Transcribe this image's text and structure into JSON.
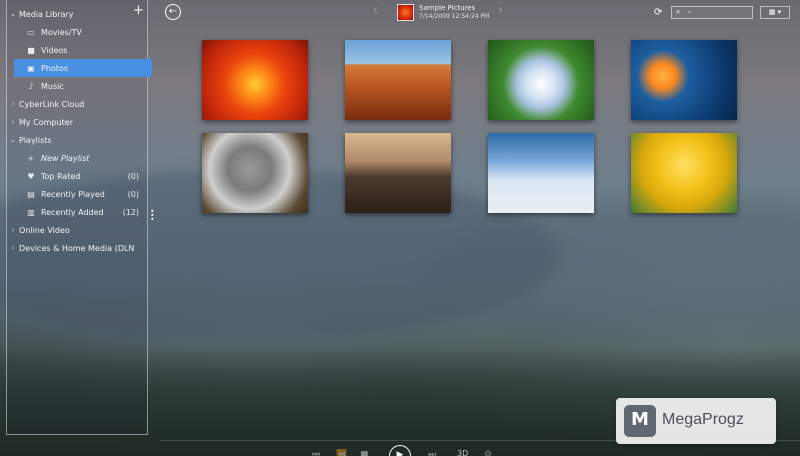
{
  "sidebar": {
    "add_icon": "plus-icon",
    "items": [
      {
        "label": "Media Library",
        "level": 0,
        "chevron": "down",
        "icon": ""
      },
      {
        "label": "Movies/TV",
        "level": 1,
        "chevron": "",
        "icon": "tv-icon"
      },
      {
        "label": "Videos",
        "level": 1,
        "chevron": "",
        "icon": "video-camera-icon"
      },
      {
        "label": "Photos",
        "level": 1,
        "chevron": "",
        "icon": "photo-icon",
        "selected": true
      },
      {
        "label": "Music",
        "level": 1,
        "chevron": "",
        "icon": "music-note-icon"
      },
      {
        "label": "CyberLink Cloud",
        "level": 0,
        "chevron": "right",
        "icon": ""
      },
      {
        "label": "My Computer",
        "level": 0,
        "chevron": "right",
        "icon": ""
      },
      {
        "label": "Playlists",
        "level": 0,
        "chevron": "down",
        "icon": ""
      },
      {
        "label": "New Playlist",
        "level": 1,
        "chevron": "",
        "icon": "plus-icon",
        "italic": true
      },
      {
        "label": "Top Rated",
        "level": 1,
        "chevron": "",
        "icon": "heart-icon",
        "count": "(0)"
      },
      {
        "label": "Recently Played",
        "level": 1,
        "chevron": "",
        "icon": "recent-play-icon",
        "count": "(0)"
      },
      {
        "label": "Recently Added",
        "level": 1,
        "chevron": "",
        "icon": "recent-add-icon",
        "count": "(12)"
      },
      {
        "label": "Online Video",
        "level": 0,
        "chevron": "right",
        "icon": ""
      },
      {
        "label": "Devices & Home Media (DLN",
        "level": 0,
        "chevron": "right",
        "icon": ""
      }
    ]
  },
  "header": {
    "album_title": "Sample Pictures",
    "album_date": "7/14/2009 12:54:24 PM",
    "view_toggle": "▦ ▾"
  },
  "photos": [
    {
      "subject": "flower-photo"
    },
    {
      "subject": "desert-photo"
    },
    {
      "subject": "hydrangea-photo"
    },
    {
      "subject": "jellyfish-photo"
    },
    {
      "subject": "koala-photo"
    },
    {
      "subject": "lighthouse-photo"
    },
    {
      "subject": "penguins-photo"
    },
    {
      "subject": "tulips-photo"
    }
  ],
  "playbar": {
    "mode_label": "3D"
  },
  "watermark": {
    "text": "MegaProgz"
  }
}
